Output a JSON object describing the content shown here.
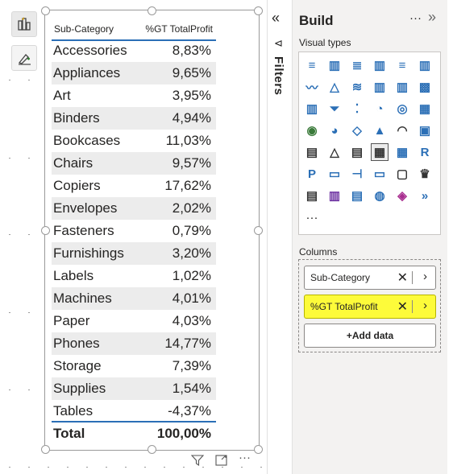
{
  "table": {
    "headers": [
      "Sub-Category",
      "%GT TotalProfit"
    ],
    "rows": [
      {
        "category": "Accessories",
        "value": "8,83%"
      },
      {
        "category": "Appliances",
        "value": "9,65%"
      },
      {
        "category": "Art",
        "value": "3,95%"
      },
      {
        "category": "Binders",
        "value": "4,94%"
      },
      {
        "category": "Bookcases",
        "value": "11,03%"
      },
      {
        "category": "Chairs",
        "value": "9,57%"
      },
      {
        "category": "Copiers",
        "value": "17,62%"
      },
      {
        "category": "Envelopes",
        "value": "2,02%"
      },
      {
        "category": "Fasteners",
        "value": "0,79%"
      },
      {
        "category": "Furnishings",
        "value": "3,20%"
      },
      {
        "category": "Labels",
        "value": "1,02%"
      },
      {
        "category": "Machines",
        "value": "4,01%"
      },
      {
        "category": "Paper",
        "value": "4,03%"
      },
      {
        "category": "Phones",
        "value": "14,77%"
      },
      {
        "category": "Storage",
        "value": "7,39%"
      },
      {
        "category": "Supplies",
        "value": "1,54%"
      },
      {
        "category": "Tables",
        "value": "-4,37%"
      }
    ],
    "total": {
      "label": "Total",
      "value": "100,00%"
    }
  },
  "filters": {
    "label": "Filters",
    "collapse_glyph": "«",
    "funnel_glyph": "⊲"
  },
  "build": {
    "title": "Build",
    "more_glyph": "···",
    "expand_glyph": "»",
    "visual_types_label": "Visual types",
    "visual_types_more": "···",
    "columns_label": "Columns",
    "fields": [
      {
        "label": "Sub-Category",
        "remove": "✕",
        "chevron": "›",
        "highlighted": false
      },
      {
        "label": "%GT TotalProfit",
        "remove": "✕",
        "chevron": "›",
        "highlighted": true
      }
    ],
    "add_data_label": "+Add data"
  },
  "footer": {
    "more_glyph": "···"
  },
  "colors": {
    "accent_blue": "#2b6fb6",
    "highlight_yellow": "#fdfb3a",
    "pane_bg": "#f3f2f1"
  },
  "icons": {
    "left_toolbar": [
      "report-pages-icon",
      "format-brush-icon"
    ],
    "visual_footer": [
      "filter-icon",
      "focus-mode-icon",
      "more-options-icon"
    ]
  }
}
